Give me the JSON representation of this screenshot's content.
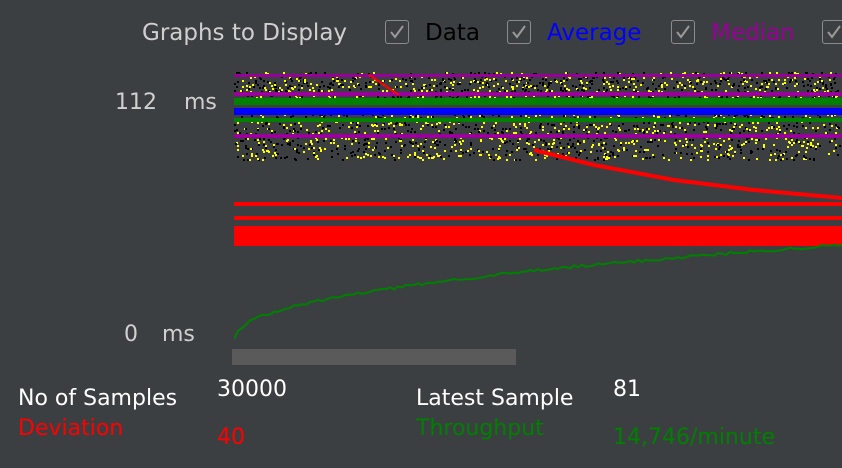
{
  "header": {
    "title": "Graphs to Display",
    "checkboxes": [
      {
        "label": "Data",
        "checked": true,
        "color": "#000000"
      },
      {
        "label": "Average",
        "checked": true,
        "color": "#0000ff"
      },
      {
        "label": "Median",
        "checked": true,
        "color": "#990099"
      },
      {
        "label": "",
        "checked": true,
        "color": "#ff0000"
      }
    ]
  },
  "y_axis": {
    "top_value": "112",
    "top_unit": "ms",
    "bottom_value": "0",
    "bottom_unit": "ms"
  },
  "stats": {
    "samples_label": "No of Samples",
    "samples_value": "30000",
    "deviation_label": "Deviation",
    "deviation_value": "40",
    "latest_label": "Latest Sample",
    "latest_value": "81",
    "throughput_label": "Throughput",
    "throughput_value": "14,746/minute"
  },
  "colors": {
    "data": "#000000",
    "data_alt": "#ffff00",
    "average": "#0000ff",
    "median": "#990099",
    "deviation": "#ff0000",
    "throughput": "#008000",
    "background": "#3c3f41"
  }
}
